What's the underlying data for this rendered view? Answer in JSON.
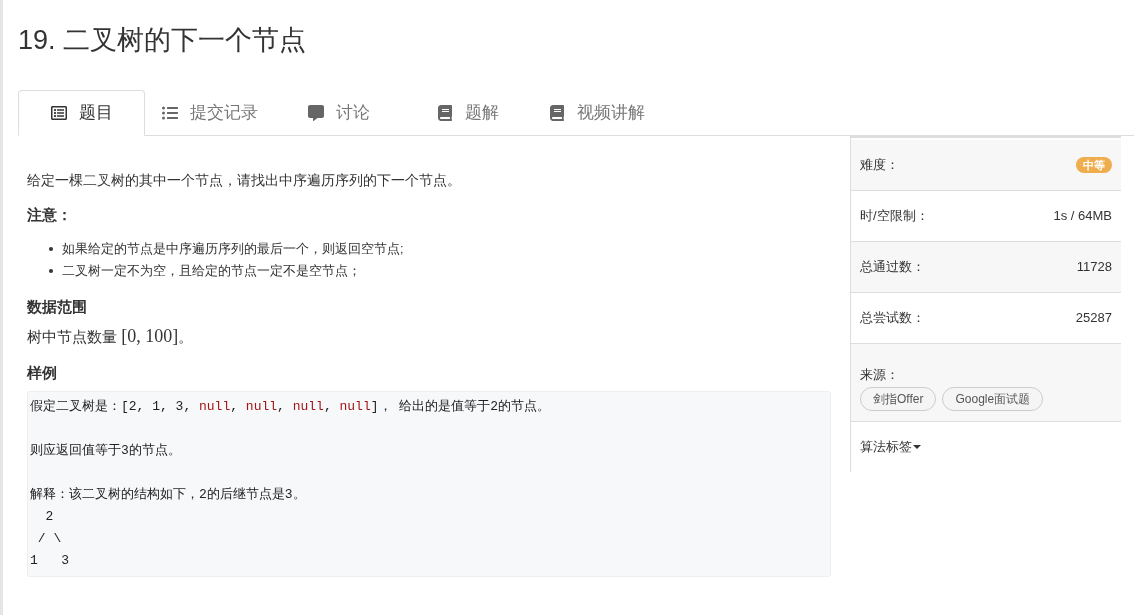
{
  "title": "19. 二叉树的下一个节点",
  "tabs": [
    {
      "label": "题目",
      "kind": "problem",
      "selected": true
    },
    {
      "label": "提交记录",
      "kind": "submissions",
      "selected": false
    },
    {
      "label": "讨论",
      "kind": "discussion",
      "selected": false
    },
    {
      "label": "题解",
      "kind": "solution",
      "selected": false
    },
    {
      "label": "视频讲解",
      "kind": "video",
      "selected": false
    }
  ],
  "description": "给定一棵二叉树的其中一个节点，请找出中序遍历序列的下一个节点。",
  "notes_heading": "注意：",
  "notes": [
    "如果给定的节点是中序遍历序列的最后一个，则返回空节点;",
    "二叉树一定不为空，且给定的节点一定不是空节点；"
  ],
  "range_heading": "数据范围",
  "range_text": "树中节点数量",
  "range_math": "[0, 100]",
  "range_end": "。",
  "example_heading": "样例",
  "example": [
    [
      [
        {
          "kind": "plain",
          "text": "假定二叉树是：[2, 1, 3, "
        },
        {
          "kind": "keyword",
          "text": "null"
        },
        {
          "kind": "plain",
          "text": ", "
        },
        {
          "kind": "keyword",
          "text": "null"
        },
        {
          "kind": "plain",
          "text": ", "
        },
        {
          "kind": "keyword",
          "text": "null"
        },
        {
          "kind": "plain",
          "text": ", "
        },
        {
          "kind": "keyword",
          "text": "null"
        },
        {
          "kind": "plain",
          "text": "]， 给出的是值等于2的节点。"
        }
      ]
    ],
    [
      [
        {
          "kind": "plain",
          "text": "则应返回值等于3的节点。"
        }
      ]
    ],
    [
      [
        {
          "kind": "plain",
          "text": "解释：该二叉树的结构如下，2的后继节点是3。"
        }
      ],
      [
        {
          "kind": "plain",
          "text": "  2"
        }
      ],
      [
        {
          "kind": "plain",
          "text": " / \\"
        }
      ],
      [
        {
          "kind": "plain",
          "text": "1   3"
        }
      ]
    ]
  ],
  "sidebar": [
    {
      "kind": "badge",
      "label": "难度：",
      "value": "中等",
      "color": "#f0ad4e"
    },
    {
      "kind": "value",
      "label": "时/空限制：",
      "value": "1s / 64MB"
    },
    {
      "kind": "value",
      "label": "总通过数：",
      "value": "11728"
    },
    {
      "kind": "value",
      "label": "总尝试数：",
      "value": "25287"
    },
    {
      "kind": "tags",
      "label": "来源：",
      "tags": [
        "剑指Offer",
        "Google面试题"
      ]
    },
    {
      "kind": "dropdown",
      "label": "算法标签"
    }
  ]
}
